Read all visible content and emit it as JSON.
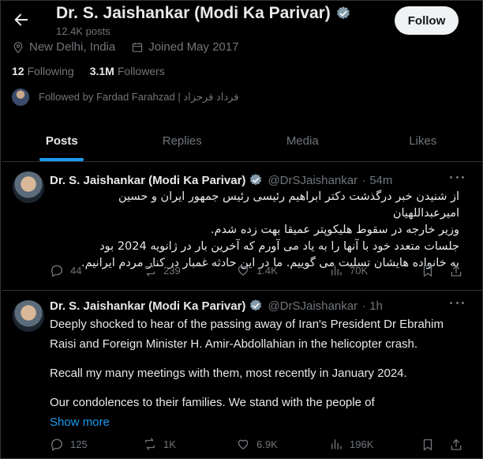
{
  "header": {
    "name": "Dr. S. Jaishankar (Modi Ka Parivar)",
    "posts_count": "12.4K posts",
    "follow_label": "Follow"
  },
  "profile": {
    "location": "New Delhi, India",
    "joined": "Joined May 2017",
    "following_count": "12",
    "following_label": "Following",
    "followers_count": "3.1M",
    "followers_label": "Followers",
    "followed_by": "Followed by Fardad Farahzad | فرداد فرحزاد"
  },
  "tabs": [
    {
      "label": "Posts"
    },
    {
      "label": "Replies"
    },
    {
      "label": "Media"
    },
    {
      "label": "Likes"
    }
  ],
  "tweets": [
    {
      "name": "Dr. S. Jaishankar (Modi Ka Parivar)",
      "handle": "@DrSJaishankar",
      "time": "· 54m",
      "body_lines": [
        "از شنیدن خبر درگذشت دکتر ابراهیم رئیسی رئیس جمهور ایران و حسین امیرعبداللهیان",
        "وزیر خارجه در سقوط هلیکوپتر عمیقا بهت زده شدم.",
        "جلسات متعدد خود با آنها را به یاد می آورم که آخرین بار در ژانویه 2024 بود",
        "به خانواده هایشان تسلیت می گوییم. ما در این حادثه غمبار در کنار مردم ایرانیم."
      ],
      "replies": "44",
      "reposts": "239",
      "likes": "1.4K",
      "views": "70K"
    },
    {
      "name": "Dr. S. Jaishankar (Modi Ka Parivar)",
      "handle": "@DrSJaishankar",
      "time": "· 1h",
      "paragraphs": [
        "Deeply shocked to hear of the passing away of Iran's President Dr Ebrahim Raisi and Foreign Minister H. Amir-Abdollahian in the helicopter crash.",
        "Recall my many meetings with them, most recently in January 2024.",
        "Our condolences to their families. We stand with the people of"
      ],
      "show_more": "Show more",
      "replies": "125",
      "reposts": "1K",
      "likes": "6.9K",
      "views": "196K"
    }
  ],
  "colors": {
    "background": "#000000",
    "text": "#e7e9ea",
    "muted": "#71767b",
    "accent": "#1d9bf0",
    "follow_bg": "#eff3f4"
  }
}
